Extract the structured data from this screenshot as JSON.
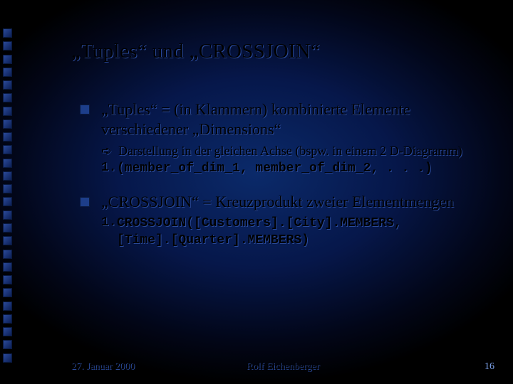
{
  "title": "„Tuples“ und „CROSSJOIN“",
  "bullets": [
    {
      "text": "„Tuples“ = (in Klammern) kombinierte Elemente verschiedener „Dimensions“",
      "sub": {
        "note": "Darstellung in der gleichen Achse (bspw. in einem 2 D-Diagramm)",
        "code_num": "1.",
        "code": "(member_of_dim_1, member_of_dim_2, . . .)"
      }
    },
    {
      "text": "„CROSSJOIN“ = Kreuzprodukt zweier Elementmengen",
      "sub": {
        "code_num": "1.",
        "code": "CROSSJOIN([Customers].[City].MEMBERS,\n[Time].[Quarter].MEMBERS)"
      }
    }
  ],
  "footer": {
    "date": "27. Januar 2000",
    "author": "Rolf Eichenberger",
    "page": "16"
  }
}
